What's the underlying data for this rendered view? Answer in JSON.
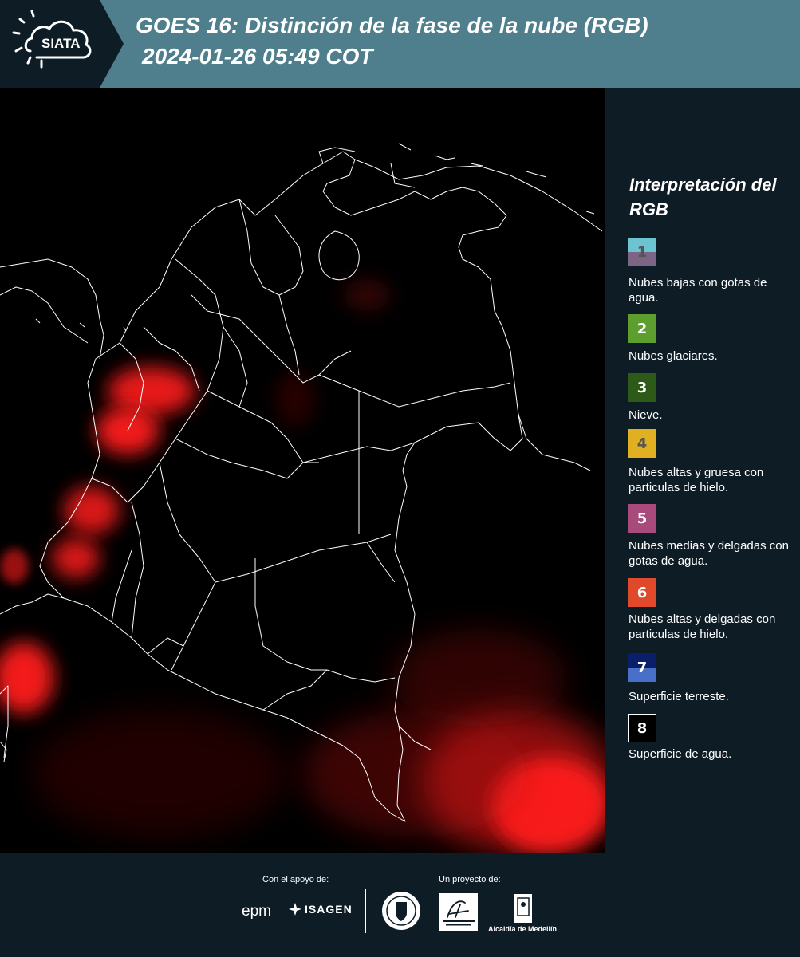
{
  "header": {
    "logo_text": "SIATA",
    "title_line1": "GOES 16: Distinción de la fase de la nube (RGB)",
    "title_line2": "2024-01-26 05:49 COT"
  },
  "legend": {
    "title": "Interpretación del RGB",
    "items": [
      {
        "number": "1",
        "description": "Nubes bajas con gotas de agua.",
        "color_top": "#6cc4d0",
        "color_bottom": "#7d6585",
        "text_color": "#555555"
      },
      {
        "number": "2",
        "description": "Nubes glaciares.",
        "color_top": "#5e9e2e",
        "color_bottom": "#5e9e2e",
        "text_color": "#ffffff"
      },
      {
        "number": "3",
        "description": "Nieve.",
        "color_top": "#2d5a18",
        "color_bottom": "#2d5a18",
        "text_color": "#ffffff"
      },
      {
        "number": "4",
        "description": "Nubes altas y gruesa con particulas de hielo.",
        "color_top": "#e0b020",
        "color_bottom": "#e0b020",
        "text_color": "#555555"
      },
      {
        "number": "5",
        "description": "Nubes medias y delgadas con gotas de agua.",
        "color_top": "#a84a7c",
        "color_bottom": "#a84a7c",
        "text_color": "#ffffff"
      },
      {
        "number": "6",
        "description": "Nubes altas y delgadas con particulas de hielo.",
        "color_top": "#e04a2a",
        "color_bottom": "#e04a2a",
        "text_color": "#ffffff"
      },
      {
        "number": "7",
        "description": "Superficie terreste.",
        "color_top": "#0a1e6a",
        "color_bottom": "#4870c8",
        "text_color": "#ffffff"
      },
      {
        "number": "8",
        "description": "Superficie de agua.",
        "color_top": "#000000",
        "color_bottom": "#000000",
        "text_color": "#ffffff"
      }
    ]
  },
  "footer": {
    "support_label": "Con el apoyo de:",
    "project_label": "Un proyecto de:",
    "sponsors": [
      "epm",
      "ISAGEN"
    ],
    "partners": [
      "Área Metropolitana Valle de Aburrá",
      "Alcaldía de Medellín"
    ],
    "medellin_label": "Alcaldía de Medellín"
  },
  "colors": {
    "header_bg": "#4f7f8c",
    "page_bg": "#0e1c26",
    "map_bg": "#000000",
    "cloud_red": "#ff1a1a",
    "border_line": "#ffffff"
  }
}
